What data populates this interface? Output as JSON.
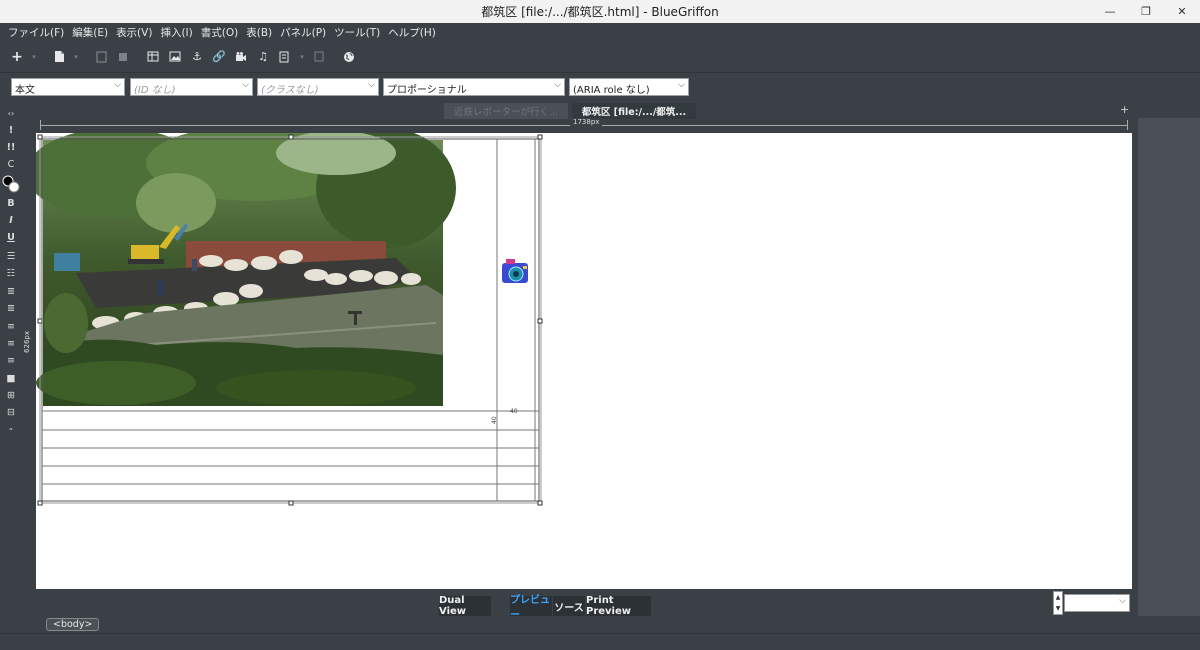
{
  "window": {
    "title": "都筑区 [file:/.../都筑区.html] - BlueGriffon",
    "minimize": "—",
    "restore": "❐",
    "close": "✕"
  },
  "menu": [
    "ファイル(F)",
    "編集(E)",
    "表示(V)",
    "挿入(I)",
    "書式(O)",
    "表(B)",
    "パネル(P)",
    "ツール(T)",
    "ヘルプ(H)"
  ],
  "format_bar": {
    "paragraph": "本文",
    "id": "(ID なし)",
    "class": "(クラスなし)",
    "font": "プロポーショナル",
    "aria": "(ARIA role なし)"
  },
  "tabs": {
    "inactive": "近鉄レポーターが行く...",
    "active": "都筑区 [file:/.../都筑..."
  },
  "ruler": {
    "width_label": "1738px",
    "height_label": "626px"
  },
  "table_widget": {
    "col_label": "40",
    "row_label": "40"
  },
  "view_buttons": {
    "dual": "Dual View",
    "preview": "プレビュー",
    "source": "ソース",
    "print": "Print Preview"
  },
  "status": {
    "crumb": "<body>"
  },
  "colors": {
    "chrome_bg": "#3a4045",
    "titlebar_bg": "#f2f2f2",
    "canvas_bg": "#ffffff",
    "preview_active": "#3aa3ff"
  }
}
